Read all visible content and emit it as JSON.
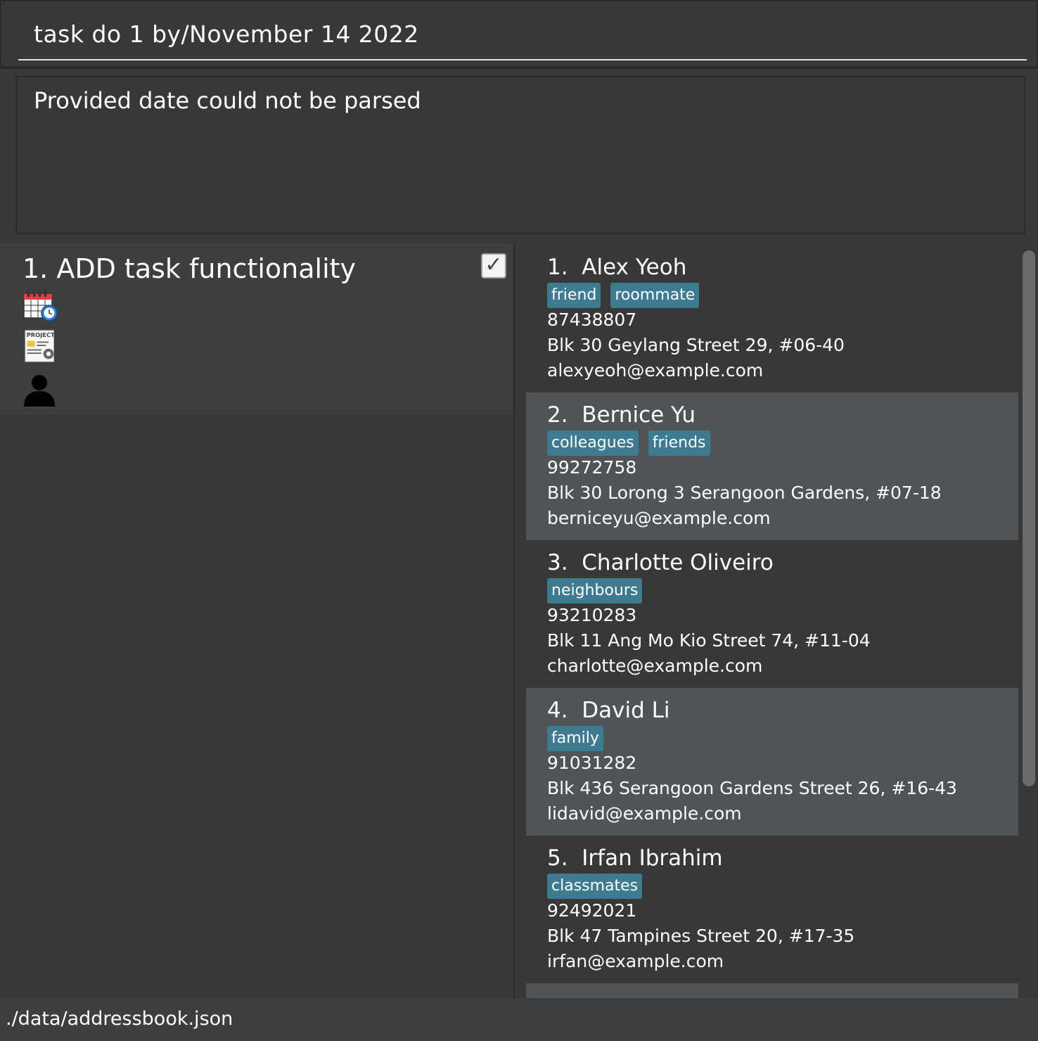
{
  "command_box": {
    "value": "task do 1 by/November 14 2022"
  },
  "result_display": {
    "message": "Provided date could not be parsed"
  },
  "tasks": [
    {
      "title": "1. ADD task functionality",
      "done": true,
      "icons": [
        "calendar-clock-icon",
        "project-document-icon",
        "person-icon"
      ]
    }
  ],
  "persons": [
    {
      "name": "1.  Alex Yeoh",
      "tags": [
        "friend",
        "roommate"
      ],
      "phone": "87438807",
      "address": "Blk 30 Geylang Street 29, #06-40",
      "email": "alexyeoh@example.com"
    },
    {
      "name": "2.  Bernice Yu",
      "tags": [
        "colleagues",
        "friends"
      ],
      "phone": "99272758",
      "address": "Blk 30 Lorong 3 Serangoon Gardens, #07-18",
      "email": "berniceyu@example.com"
    },
    {
      "name": "3.  Charlotte Oliveiro",
      "tags": [
        "neighbours"
      ],
      "phone": "93210283",
      "address": "Blk 11 Ang Mo Kio Street 74, #11-04",
      "email": "charlotte@example.com"
    },
    {
      "name": "4.  David Li",
      "tags": [
        "family"
      ],
      "phone": "91031282",
      "address": "Blk 436 Serangoon Gardens Street 26, #16-43",
      "email": "lidavid@example.com"
    },
    {
      "name": "5.  Irfan Ibrahim",
      "tags": [
        "classmates"
      ],
      "phone": "92492021",
      "address": "Blk 47 Tampines Street 20, #17-35",
      "email": "irfan@example.com"
    }
  ],
  "status_bar": {
    "path": "./data/addressbook.json"
  },
  "colors": {
    "background": "#383838",
    "tag": "#3e7b91",
    "card_alt": "#4f5457",
    "task_card": "#3c3e3f"
  }
}
